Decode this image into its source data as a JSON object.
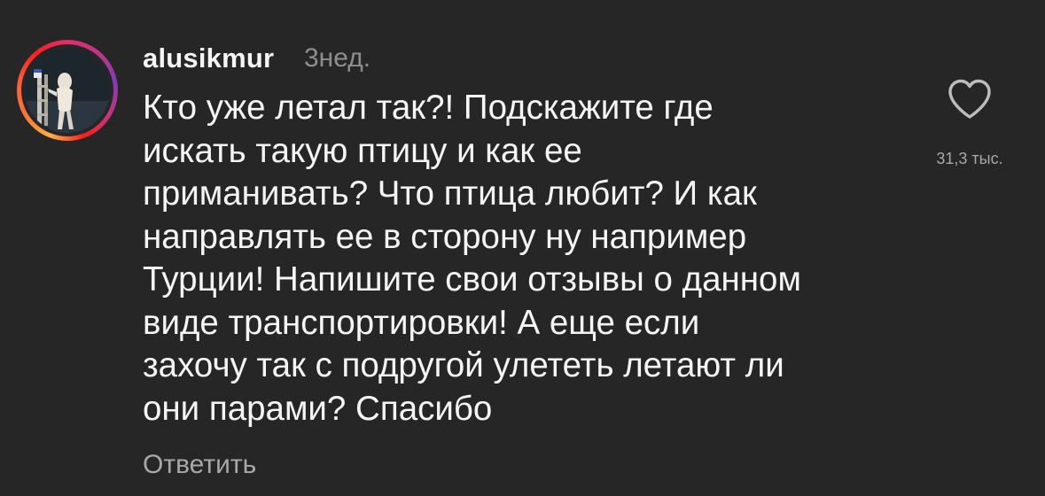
{
  "comment": {
    "username": "alusikmur",
    "time": "3нед.",
    "text_lines": [
      "Кто уже летал так?! Подскажите где",
      "искать такую птицу и как ее",
      "приманивать? Что птица любит? И как",
      "направлять ее в сторону ну например",
      "Турции! Напишите свои отзывы о данном",
      "виде транспортировки! А еще если",
      "захочу так с подругой улететь летают ли",
      "они парами? Спасибо"
    ],
    "reply_label": "Ответить",
    "like_count": "31,3 тыс.",
    "like_icon": "heart-outline-icon"
  },
  "colors": {
    "background": "#262626",
    "text": "#f5f5f5",
    "secondary_text": "#8e8e8e",
    "story_ring_start": "#fcaf45",
    "story_ring_end": "#c13584"
  }
}
